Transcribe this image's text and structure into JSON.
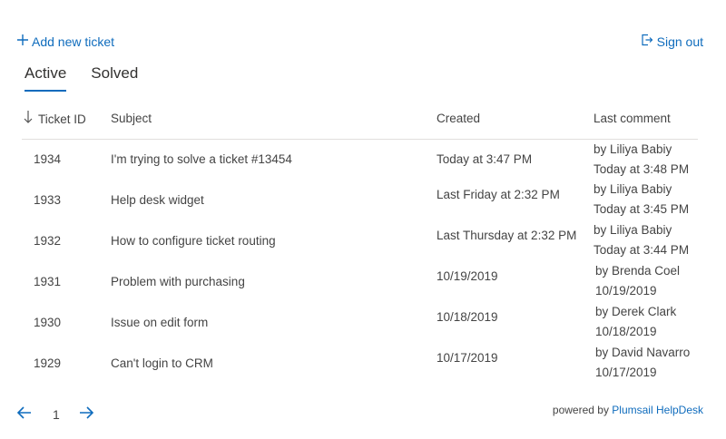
{
  "toolbar": {
    "add_label": "Add new ticket",
    "signout_label": "Sign out"
  },
  "tabs": [
    {
      "label": "Active"
    },
    {
      "label": "Solved"
    }
  ],
  "columns": {
    "id": "Ticket ID",
    "subject": "Subject",
    "created": "Created",
    "last": "Last comment"
  },
  "rows": [
    {
      "id": "1934",
      "subject": "I'm trying to solve a ticket #13454",
      "created": "Today at 3:47 PM",
      "by": "by Liliya Babiy",
      "when": "Today at 3:48 PM"
    },
    {
      "id": "1933",
      "subject": "Help desk widget",
      "created": "Last Friday at 2:32 PM",
      "by": "by Liliya Babiy",
      "when": "Today at 3:45 PM"
    },
    {
      "id": "1932",
      "subject": "How to configure ticket routing",
      "created": "Last Thursday at 2:32 PM",
      "by": "by Liliya Babiy",
      "when": "Today at 3:44 PM"
    },
    {
      "id": "1931",
      "subject": "Problem with purchasing",
      "created": "10/19/2019",
      "by": "by Brenda Coel",
      "when": "10/19/2019"
    },
    {
      "id": "1930",
      "subject": "Issue on edit form",
      "created": "10/18/2019",
      "by": "by Derek Clark",
      "when": "10/18/2019"
    },
    {
      "id": "1929",
      "subject": "Can't login to CRM",
      "created": "10/17/2019",
      "by": "by David Navarro",
      "when": "10/17/2019"
    }
  ],
  "pager": {
    "page": "1"
  },
  "footer": {
    "powered_prefix": "powered by",
    "brand": "Plumsail HelpDesk"
  },
  "colors": {
    "accent": "#0f6cbd",
    "text": "#323130",
    "border": "#e1dfdd"
  }
}
